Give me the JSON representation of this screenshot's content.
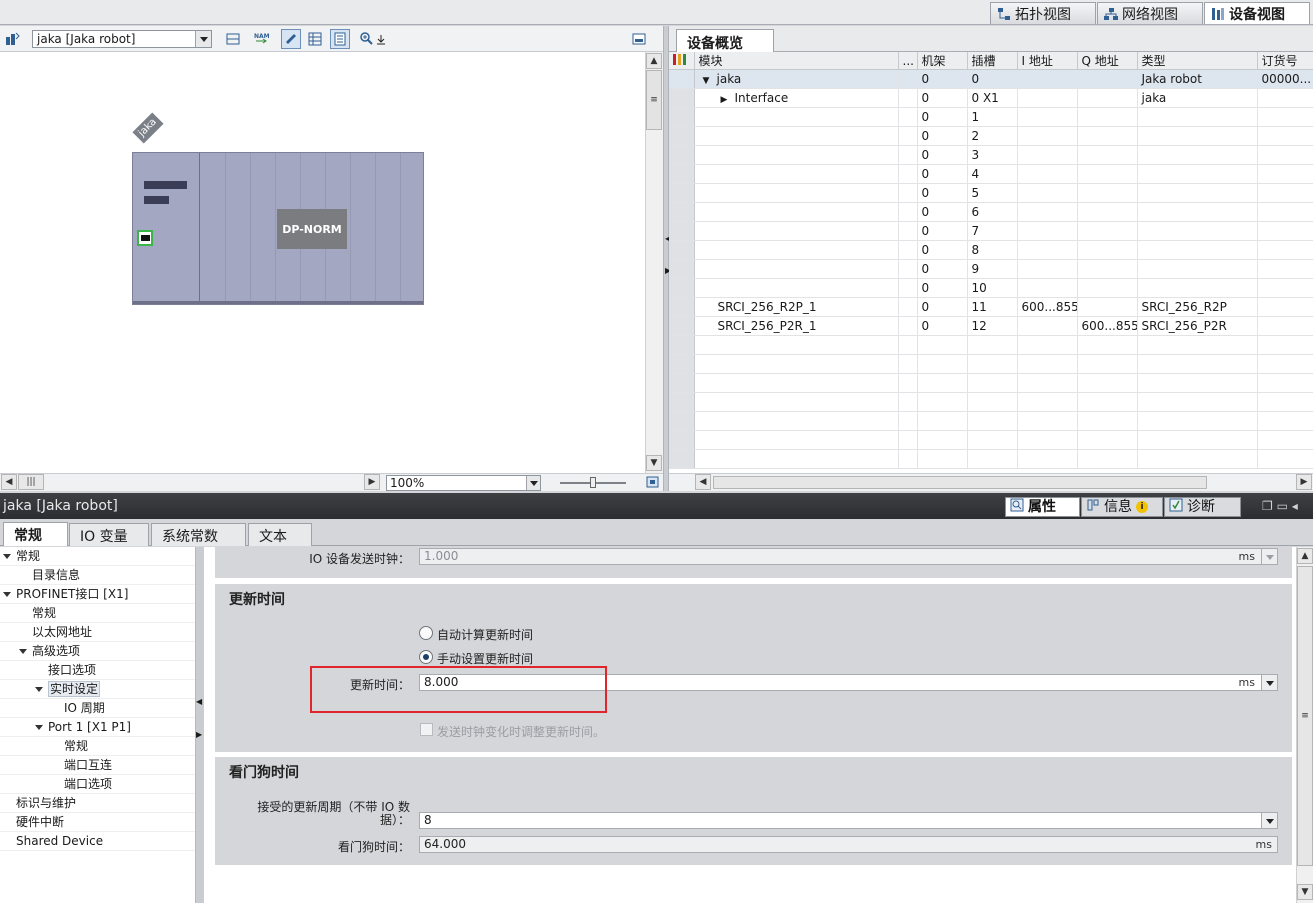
{
  "view_tabs": [
    {
      "label": "拓扑视图",
      "active": false,
      "icon": "topology-icon"
    },
    {
      "label": "网络视图",
      "active": false,
      "icon": "network-icon"
    },
    {
      "label": "设备视图",
      "active": true,
      "icon": "device-icon"
    }
  ],
  "device_view": {
    "device_select": "jaka [Jaka robot]",
    "zoom": "100%",
    "device_tag": "jaka",
    "module_label": "DP-NORM"
  },
  "overview": {
    "tab_label": "设备概览",
    "columns": [
      "模块",
      "...",
      "机架",
      "插槽",
      "I 地址",
      "Q 地址",
      "类型",
      "订货号"
    ],
    "rows": [
      {
        "module": "jaka",
        "rack": "0",
        "slot": "0",
        "i_addr": "",
        "q_addr": "",
        "type": "Jaka robot",
        "order": "00000..."
      },
      {
        "module": "Interface",
        "rack": "0",
        "slot": "0 X1",
        "i_addr": "",
        "q_addr": "",
        "type": "jaka",
        "order": ""
      },
      {
        "module": "",
        "rack": "0",
        "slot": "1",
        "i_addr": "",
        "q_addr": "",
        "type": "",
        "order": ""
      },
      {
        "module": "",
        "rack": "0",
        "slot": "2",
        "i_addr": "",
        "q_addr": "",
        "type": "",
        "order": ""
      },
      {
        "module": "",
        "rack": "0",
        "slot": "3",
        "i_addr": "",
        "q_addr": "",
        "type": "",
        "order": ""
      },
      {
        "module": "",
        "rack": "0",
        "slot": "4",
        "i_addr": "",
        "q_addr": "",
        "type": "",
        "order": ""
      },
      {
        "module": "",
        "rack": "0",
        "slot": "5",
        "i_addr": "",
        "q_addr": "",
        "type": "",
        "order": ""
      },
      {
        "module": "",
        "rack": "0",
        "slot": "6",
        "i_addr": "",
        "q_addr": "",
        "type": "",
        "order": ""
      },
      {
        "module": "",
        "rack": "0",
        "slot": "7",
        "i_addr": "",
        "q_addr": "",
        "type": "",
        "order": ""
      },
      {
        "module": "",
        "rack": "0",
        "slot": "8",
        "i_addr": "",
        "q_addr": "",
        "type": "",
        "order": ""
      },
      {
        "module": "",
        "rack": "0",
        "slot": "9",
        "i_addr": "",
        "q_addr": "",
        "type": "",
        "order": ""
      },
      {
        "module": "",
        "rack": "0",
        "slot": "10",
        "i_addr": "",
        "q_addr": "",
        "type": "",
        "order": ""
      },
      {
        "module": "SRCI_256_R2P_1",
        "rack": "0",
        "slot": "11",
        "i_addr": "600...855",
        "q_addr": "",
        "type": "SRCI_256_R2P",
        "order": ""
      },
      {
        "module": "SRCI_256_P2R_1",
        "rack": "0",
        "slot": "12",
        "i_addr": "",
        "q_addr": "600...855",
        "type": "SRCI_256_P2R",
        "order": ""
      }
    ]
  },
  "inspector": {
    "title": "jaka [Jaka robot]",
    "right_tabs": [
      {
        "label": "属性",
        "icon": "properties-icon"
      },
      {
        "label": "信息",
        "icon": "info-icon"
      },
      {
        "label": "诊断",
        "icon": "diagnostics-icon"
      }
    ],
    "tabs": [
      "常规",
      "IO 变量",
      "系统常数",
      "文本"
    ],
    "nav": [
      {
        "label": "常规",
        "level": 0,
        "expanded": true
      },
      {
        "label": "目录信息",
        "level": 1
      },
      {
        "label": "PROFINET接口 [X1]",
        "level": 0,
        "expanded": true
      },
      {
        "label": "常规",
        "level": 1
      },
      {
        "label": "以太网地址",
        "level": 1
      },
      {
        "label": "高级选项",
        "level": 1,
        "expanded": true
      },
      {
        "label": "接口选项",
        "level": 2
      },
      {
        "label": "实时设定",
        "level": 2,
        "expanded": true,
        "selected": true
      },
      {
        "label": "IO 周期",
        "level": 3
      },
      {
        "label": "Port 1 [X1 P1]",
        "level": 2,
        "expanded": true
      },
      {
        "label": "常规",
        "level": 3
      },
      {
        "label": "端口互连",
        "level": 3
      },
      {
        "label": "端口选项",
        "level": 3
      },
      {
        "label": "标识与维护",
        "level": 0
      },
      {
        "label": "硬件中断",
        "level": 0
      },
      {
        "label": "Shared Device",
        "level": 0
      }
    ],
    "send_clock": {
      "label": "IO 设备发送时钟：",
      "value": "1.000",
      "unit": "ms"
    },
    "update_time": {
      "title": "更新时间",
      "auto_label": "自动计算更新时间",
      "manual_label": "手动设置更新时间",
      "field_label": "更新时间：",
      "value": "8.000",
      "unit": "ms",
      "adjust_label": "发送时钟变化时调整更新时间。"
    },
    "watchdog": {
      "title": "看门狗时间",
      "accepted_label": "接受的更新周期（不带 IO 数据）：",
      "accepted_value": "8",
      "time_label": "看门狗时间：",
      "time_value": "64.000",
      "unit": "ms"
    }
  },
  "colors": {
    "highlight_box": "#e0262b",
    "title_bar": "#2c2d30"
  }
}
